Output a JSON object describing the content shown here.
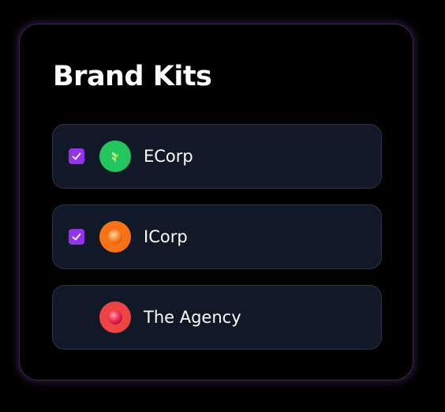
{
  "panel": {
    "title": "Brand Kits"
  },
  "brand_kits": [
    {
      "name": "ECorp",
      "checked": true,
      "logo_icon": "leaf-icon",
      "logo_color": "#22c55e"
    },
    {
      "name": "ICorp",
      "checked": true,
      "logo_icon": "orange-ball-icon",
      "logo_color": "#f97316"
    },
    {
      "name": "The Agency",
      "checked": false,
      "logo_icon": "red-ball-icon",
      "logo_color": "#ef4444"
    }
  ],
  "colors": {
    "accent": "#9333ea",
    "row_background": "#111827",
    "page_background": "#000000"
  }
}
